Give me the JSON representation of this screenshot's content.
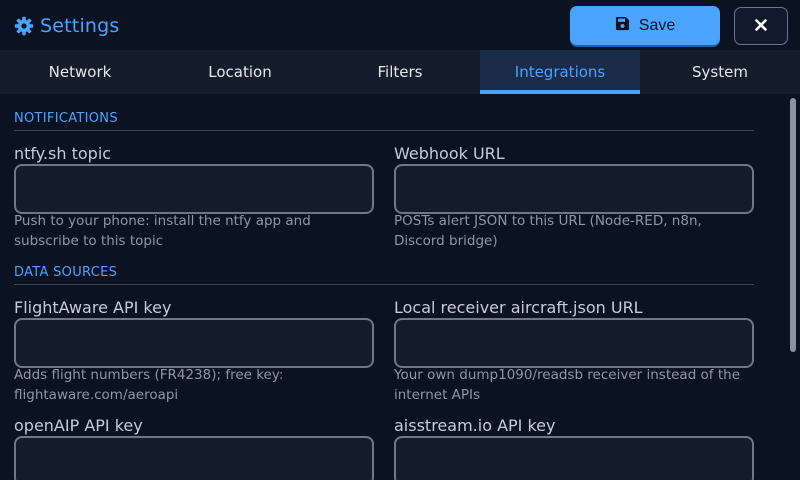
{
  "header": {
    "title": "Settings",
    "save_label": "Save"
  },
  "tabs": [
    {
      "label": "Network",
      "active": false
    },
    {
      "label": "Location",
      "active": false
    },
    {
      "label": "Filters",
      "active": false
    },
    {
      "label": "Integrations",
      "active": true
    },
    {
      "label": "System",
      "active": false
    }
  ],
  "sections": {
    "notifications": {
      "title": "NOTIFICATIONS",
      "fields": [
        {
          "label": "ntfy.sh topic",
          "value": "",
          "help": "Push to your phone: install the ntfy app and subscribe to this topic"
        },
        {
          "label": "Webhook URL",
          "value": "",
          "help": "POSTs alert JSON to this URL (Node-RED, n8n, Discord bridge)"
        }
      ]
    },
    "data_sources": {
      "title": "DATA SOURCES",
      "fields": [
        {
          "label": "FlightAware API key",
          "value": "",
          "help": "Adds flight numbers (FR4238); free key: flightaware.com/aeroapi"
        },
        {
          "label": "Local receiver aircraft.json URL",
          "value": "",
          "help": "Your own dump1090/readsb receiver instead of the internet APIs"
        },
        {
          "label": "openAIP API key",
          "value": ""
        },
        {
          "label": "aisstream.io API key",
          "value": ""
        }
      ]
    }
  },
  "colors": {
    "accent": "#4aa3ff",
    "background": "#0b1221",
    "tab_bar": "#151d2b",
    "active_tab": "#1b2c4b"
  },
  "icons": {
    "title": "gear-icon",
    "save": "floppy-disk-icon",
    "close": "close-icon"
  }
}
